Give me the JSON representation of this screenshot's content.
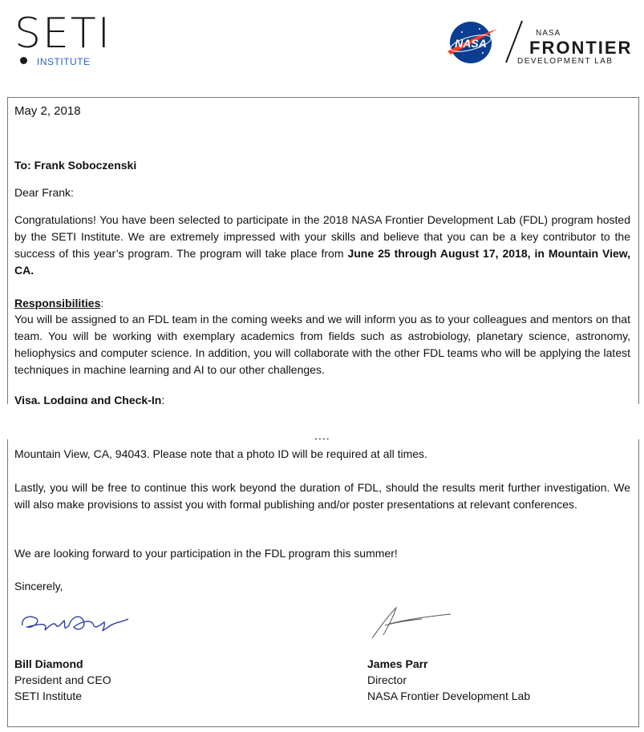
{
  "header": {
    "seti_logo": "SETI",
    "seti_sub": "INSTITUTE",
    "nasa_logo": "NASA",
    "fdl_small": "NASA",
    "fdl_big": "FRONTIER",
    "fdl_sub": "DEVELOPMENT LAB"
  },
  "letter": {
    "date": "May 2, 2018",
    "to": "To:  Frank Soboczenski",
    "salutation": "Dear Frank:",
    "congrats_a": "Congratulations! You have been selected to participate in the 2018 NASA Frontier Development Lab (FDL) program hosted by the SETI Institute.  We are extremely impressed with your skills and believe that you can be a key contributor to the success of this year’s program.  The program will take place from ",
    "congrats_bold": "June 25 through August 17, 2018, in Mountain View, CA.",
    "resp_heading": "Responsibilities",
    "resp_colon": ":",
    "resp_text": "You will be assigned to an FDL team in the coming weeks and we will inform you as to your colleagues and mentors on that team. You will be working with exemplary academics from fields such as astrobiology, planetary science, astronomy, heliophysics and computer science.  In addition, you will collaborate with the other FDL teams who will be applying the latest techniques in machine learning and AI to our other challenges.",
    "visa_heading": "Visa, Lodging and Check-In",
    "visa_colon": ":",
    "ellipsis": "....",
    "mountain": "Mountain View, CA, 94043.  Please note that a photo ID will be required at all times.",
    "lastly": "Lastly, you will be free to continue this work beyond the duration of FDL, should the results merit further investigation. We will also make provisions to assist you with formal publishing and/or poster presentations at relevant conferences.",
    "forward": "We are looking forward to your participation in the FDL program this summer!",
    "closing": "Sincerely,"
  },
  "signatories": [
    {
      "name": "Bill Diamond",
      "title": "President and CEO",
      "org": "SETI Institute"
    },
    {
      "name": "James Parr",
      "title": "Director",
      "org": "NASA Frontier Development Lab"
    }
  ]
}
